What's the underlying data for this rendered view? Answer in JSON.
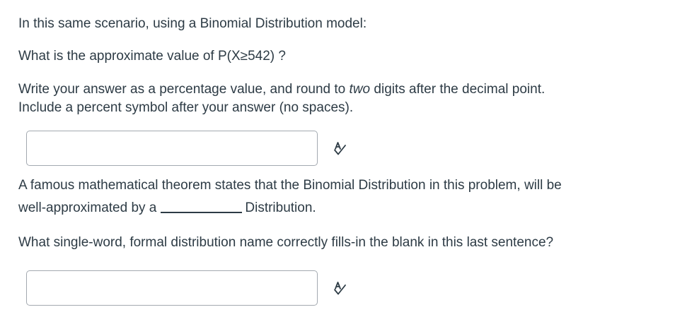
{
  "question1": {
    "intro": "In this same scenario, using a Binomial Distribution model:",
    "prompt": "What is the approximate value of P(X≥542) ?",
    "instruction_pre": "Write your answer as a percentage value, and round to ",
    "instruction_em": "two",
    "instruction_post": " digits after the decimal point.",
    "instruction_line2": "Include a percent symbol after your answer (no spaces).",
    "answer_value": "",
    "spellcheck_icon": "spellcheck-icon"
  },
  "question2": {
    "statement_line1": "A famous mathematical theorem states that the Binomial Distribution in this problem, will be",
    "statement_line2_pre": "well-approximated by a",
    "statement_line2_post": "Distribution.",
    "prompt": "What single-word, formal distribution name correctly fills-in the blank in this last sentence?",
    "answer_value": "",
    "spellcheck_icon": "spellcheck-icon"
  }
}
